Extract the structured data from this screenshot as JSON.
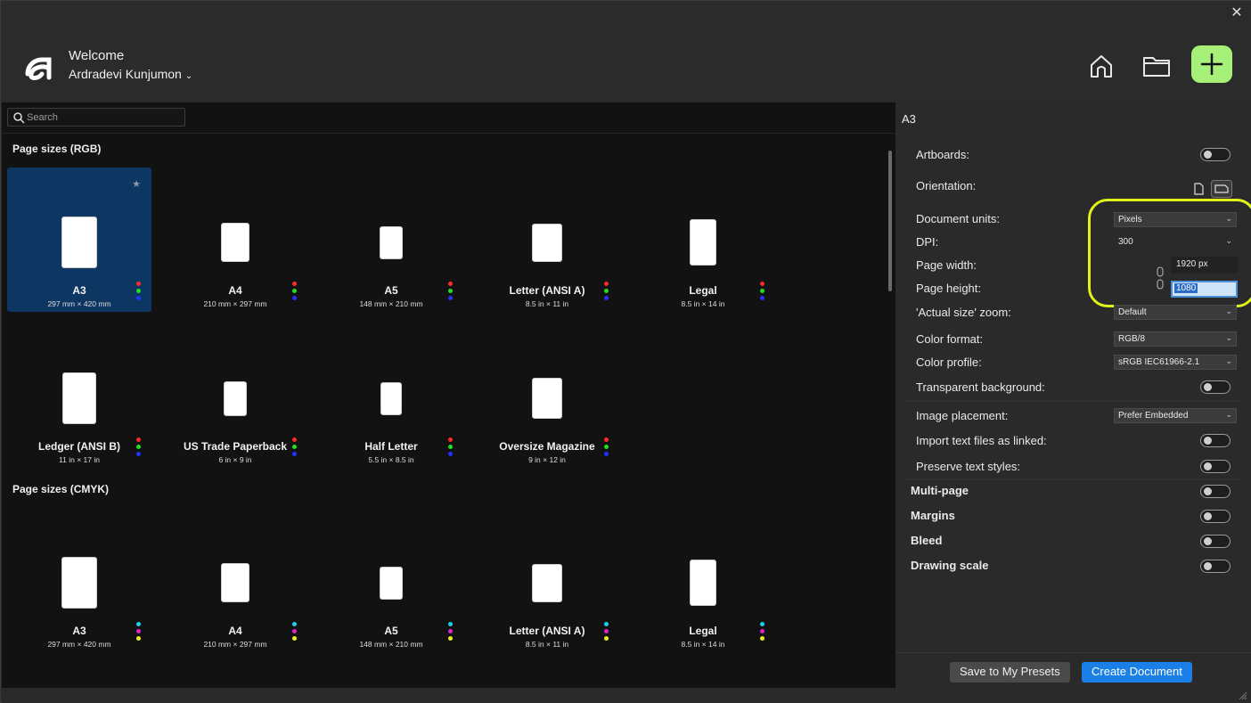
{
  "window": {
    "close_symbol": "✕"
  },
  "header": {
    "welcome": "Welcome",
    "user_name": "Ardradevi Kunjumon",
    "accent": "#a6f07a"
  },
  "search": {
    "placeholder": "Search"
  },
  "sections": {
    "rgb": "Page sizes (RGB)",
    "cmyk": "Page sizes (CMYK)"
  },
  "rgb_presets": [
    {
      "name": "A3",
      "dims": "297 mm × 420 mm",
      "selected": true
    },
    {
      "name": "A4",
      "dims": "210 mm × 297 mm"
    },
    {
      "name": "A5",
      "dims": "148 mm × 210 mm"
    },
    {
      "name": "Letter (ANSI A)",
      "dims": "8.5 in × 11 in"
    },
    {
      "name": "Legal",
      "dims": "8.5 in × 14 in"
    },
    {
      "name": "Ledger (ANSI B)",
      "dims": "11 in × 17 in"
    },
    {
      "name": "US Trade Paperback",
      "dims": "6 in × 9 in"
    },
    {
      "name": "Half Letter",
      "dims": "5.5 in × 8.5 in"
    },
    {
      "name": "Oversize Magazine",
      "dims": "9 in × 12 in"
    }
  ],
  "cmyk_presets": [
    {
      "name": "A3",
      "dims": "297 mm × 420 mm"
    },
    {
      "name": "A4",
      "dims": "210 mm × 297 mm"
    },
    {
      "name": "A5",
      "dims": "148 mm × 210 mm"
    },
    {
      "name": "Letter (ANSI A)",
      "dims": "8.5 in × 11 in"
    },
    {
      "name": "Legal",
      "dims": "8.5 in × 14 in"
    }
  ],
  "rgb_dot_colors": [
    "#ff2a2a",
    "#22dd22",
    "#2233ff"
  ],
  "cmyk_dot_colors": [
    "#22ccee",
    "#dd22cc",
    "#eeee22",
    "#111111"
  ],
  "panel": {
    "title": "A3",
    "artboards": "Artboards:",
    "orientation": "Orientation:",
    "document_units": "Document units:",
    "document_units_value": "Pixels",
    "dpi": "DPI:",
    "dpi_value": "300",
    "page_width": "Page width:",
    "page_width_value": "1920 px",
    "page_height": "Page height:",
    "page_height_value": "1080",
    "actual_size_zoom": "'Actual size' zoom:",
    "actual_size_zoom_value": "Default",
    "color_format": "Color format:",
    "color_format_value": "RGB/8",
    "color_profile": "Color profile:",
    "color_profile_value": "sRGB IEC61966-2.1",
    "transparent_background": "Transparent background:",
    "image_placement": "Image placement:",
    "image_placement_value": "Prefer Embedded",
    "import_text_linked": "Import text files as linked:",
    "preserve_text_styles": "Preserve text styles:",
    "multi_page": "Multi-page",
    "margins": "Margins",
    "bleed": "Bleed",
    "drawing_scale": "Drawing scale",
    "highlight_color": "#e1f21a"
  },
  "footer": {
    "save_presets": "Save to My Presets",
    "create_document": "Create Document"
  }
}
